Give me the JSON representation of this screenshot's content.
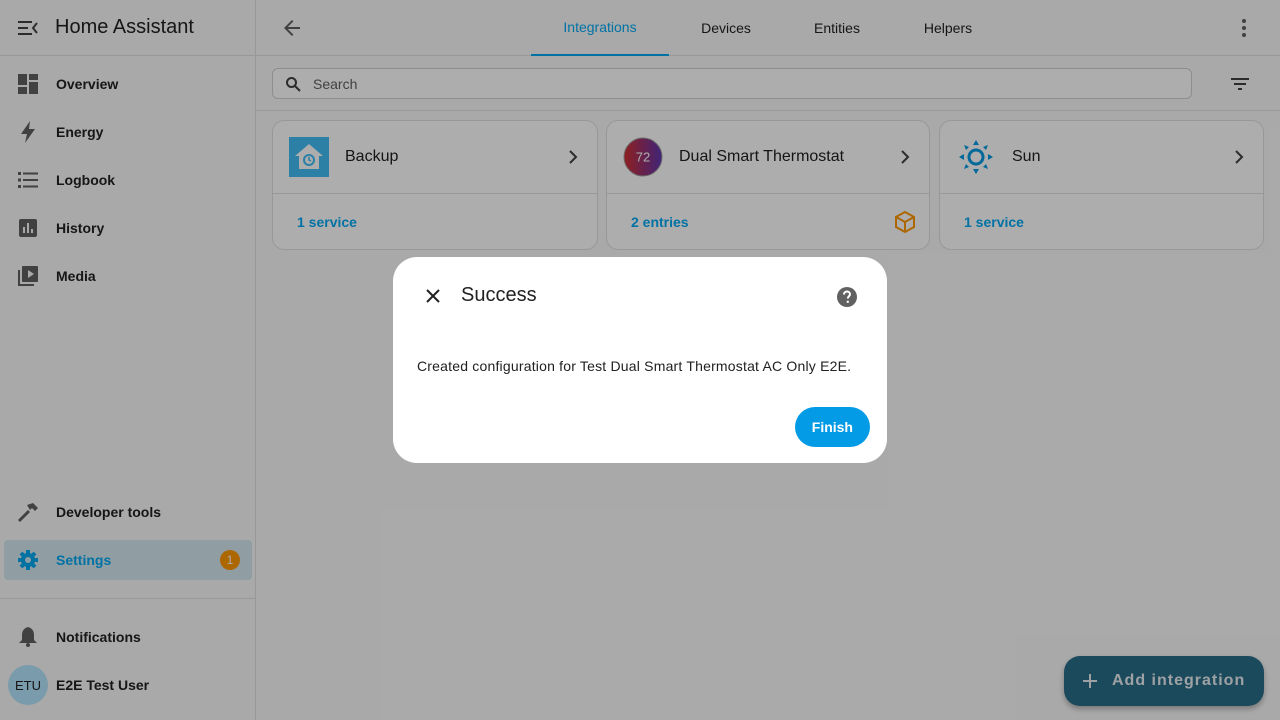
{
  "app": {
    "title": "Home Assistant"
  },
  "sidebar": {
    "items": [
      {
        "label": "Overview",
        "icon": "dashboard-icon"
      },
      {
        "label": "Energy",
        "icon": "lightning-icon"
      },
      {
        "label": "Logbook",
        "icon": "list-icon"
      },
      {
        "label": "History",
        "icon": "chart-icon"
      },
      {
        "label": "Media",
        "icon": "media-icon"
      }
    ],
    "developer_tools": "Developer tools",
    "settings": "Settings",
    "settings_badge": "1",
    "notifications": "Notifications",
    "user": {
      "initials": "ETU",
      "name": "E2E Test User"
    }
  },
  "tabs": [
    {
      "label": "Integrations",
      "active": true
    },
    {
      "label": "Devices"
    },
    {
      "label": "Entities"
    },
    {
      "label": "Helpers"
    }
  ],
  "search": {
    "placeholder": "Search",
    "value": ""
  },
  "cards": [
    {
      "title": "Backup",
      "link": "1 service",
      "logo": "backup-logo-icon"
    },
    {
      "title": "Dual Smart Thermostat",
      "link": "2 entries",
      "logo": "thermostat-logo-icon",
      "logo_text": "72",
      "extra_icon": "custom-integration-icon"
    },
    {
      "title": "Sun",
      "link": "1 service",
      "logo": "sun-logo-icon"
    }
  ],
  "dialog": {
    "title": "Success",
    "body": "Created configuration for Test Dual Smart Thermostat AC Only E2E.",
    "finish_label": "Finish"
  },
  "fab": {
    "label": "Add integration"
  },
  "colors": {
    "accent": "#03a9f4",
    "badge": "#ff9800",
    "fab": "#2a6e8a"
  }
}
